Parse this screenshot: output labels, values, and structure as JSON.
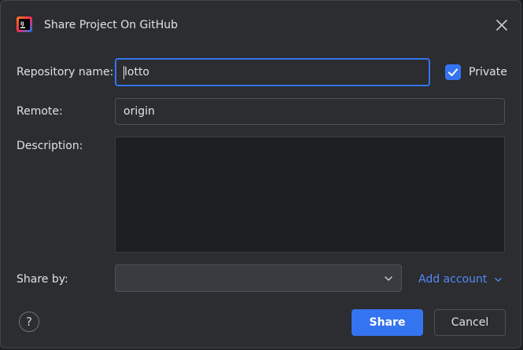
{
  "dialog": {
    "title": "Share Project On GitHub",
    "app_icon": "intellij-idea-icon",
    "close_icon": "close-icon"
  },
  "form": {
    "repository_name_label": "Repository name:",
    "repository_name_value": "lotto",
    "private_label": "Private",
    "private_checked": true,
    "remote_label": "Remote:",
    "remote_value": "origin",
    "description_label": "Description:",
    "description_value": "",
    "share_by_label": "Share by:",
    "share_by_value": "",
    "add_account_label": "Add account"
  },
  "footer": {
    "help_label": "?",
    "share_label": "Share",
    "cancel_label": "Cancel"
  },
  "colors": {
    "accent": "#3574f0",
    "link": "#548af7",
    "background": "#2b2d30"
  }
}
